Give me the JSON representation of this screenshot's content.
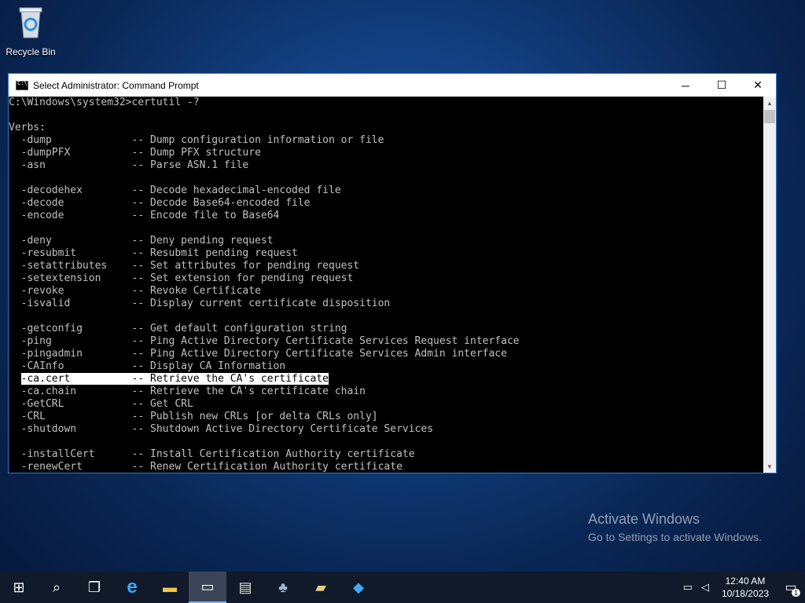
{
  "desktop": {
    "recycle_bin_label": "Recycle Bin",
    "activate_title": "Activate Windows",
    "activate_subtitle": "Go to Settings to activate Windows."
  },
  "window": {
    "title": "Select Administrator: Command Prompt",
    "minimize": "─",
    "maximize": "☐",
    "close": "✕"
  },
  "console": {
    "lines": [
      "C:\\Windows\\system32>certutil -?",
      "",
      "Verbs:",
      "  -dump             -- Dump configuration information or file",
      "  -dumpPFX          -- Dump PFX structure",
      "  -asn              -- Parse ASN.1 file",
      "",
      "  -decodehex        -- Decode hexadecimal-encoded file",
      "  -decode           -- Decode Base64-encoded file",
      "  -encode           -- Encode file to Base64",
      "",
      "  -deny             -- Deny pending request",
      "  -resubmit         -- Resubmit pending request",
      "  -setattributes    -- Set attributes for pending request",
      "  -setextension     -- Set extension for pending request",
      "  -revoke           -- Revoke Certificate",
      "  -isvalid          -- Display current certificate disposition",
      "",
      "  -getconfig        -- Get default configuration string",
      "  -ping             -- Ping Active Directory Certificate Services Request interface",
      "  -pingadmin        -- Ping Active Directory Certificate Services Admin interface",
      "  -CAInfo           -- Display CA Information",
      "  -ca.cert          -- Retrieve the CA's certificate",
      "  -ca.chain         -- Retrieve the CA's certificate chain",
      "  -GetCRL           -- Get CRL",
      "  -CRL              -- Publish new CRLs [or delta CRLs only]",
      "  -shutdown         -- Shutdown Active Directory Certificate Services",
      "",
      "  -installCert      -- Install Certification Authority certificate",
      "  -renewCert        -- Renew Certification Authority certificate"
    ],
    "selected_line_prefix": "  ",
    "selected_text": "-ca.cert          -- Retrieve the CA's certificate"
  },
  "taskbar": {
    "items": [
      {
        "name": "start-button-icon",
        "glyph": "⊞"
      },
      {
        "name": "search-icon",
        "glyph": "⌕"
      },
      {
        "name": "task-view-icon",
        "glyph": "❐"
      },
      {
        "name": "internet-explorer-icon",
        "glyph": "e"
      },
      {
        "name": "file-explorer-icon",
        "glyph": "▬"
      },
      {
        "name": "command-prompt-icon",
        "glyph": "▭"
      },
      {
        "name": "notepad-icon",
        "glyph": "▤"
      },
      {
        "name": "network-tool-icon",
        "glyph": "♣"
      },
      {
        "name": "certificate-tool-icon",
        "glyph": "▰"
      },
      {
        "name": "active-directory-icon",
        "glyph": "◆"
      }
    ],
    "active_index": 5,
    "time": "12:40 AM",
    "date": "10/18/2023",
    "notification_count": "1"
  },
  "colors": {
    "console_bg": "#000000",
    "console_fg": "#c0c0c0",
    "selection_bg": "#ffffff",
    "accent": "#2b79d0",
    "taskbar_bg": "#101a2a"
  }
}
